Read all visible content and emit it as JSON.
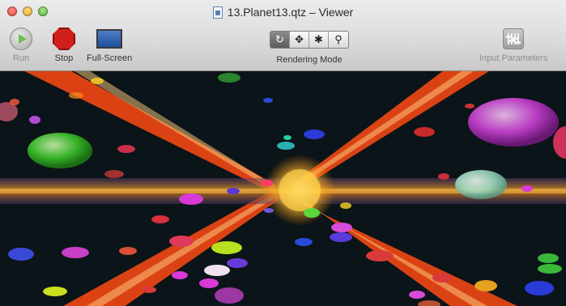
{
  "window": {
    "title": "13.Planet13.qtz – Viewer"
  },
  "toolbar": {
    "run_label": "Run",
    "stop_label": "Stop",
    "fullscreen_label": "Full-Screen",
    "rendering_mode_label": "Rendering Mode",
    "input_parameters_label": "Input Parameters",
    "rendering_modes": [
      "↻",
      "✥",
      "✱",
      "⚲"
    ],
    "active_mode_index": 0
  },
  "colors": {
    "beam": "#ff4a14",
    "horizon_band": "#e89a23",
    "background": "#0b1418"
  },
  "icons": {
    "run": "play-icon",
    "stop": "stop-sign-icon",
    "fullscreen": "screen-icon",
    "input_parameters": "sliders-icon",
    "document": "qtz-document-icon"
  }
}
